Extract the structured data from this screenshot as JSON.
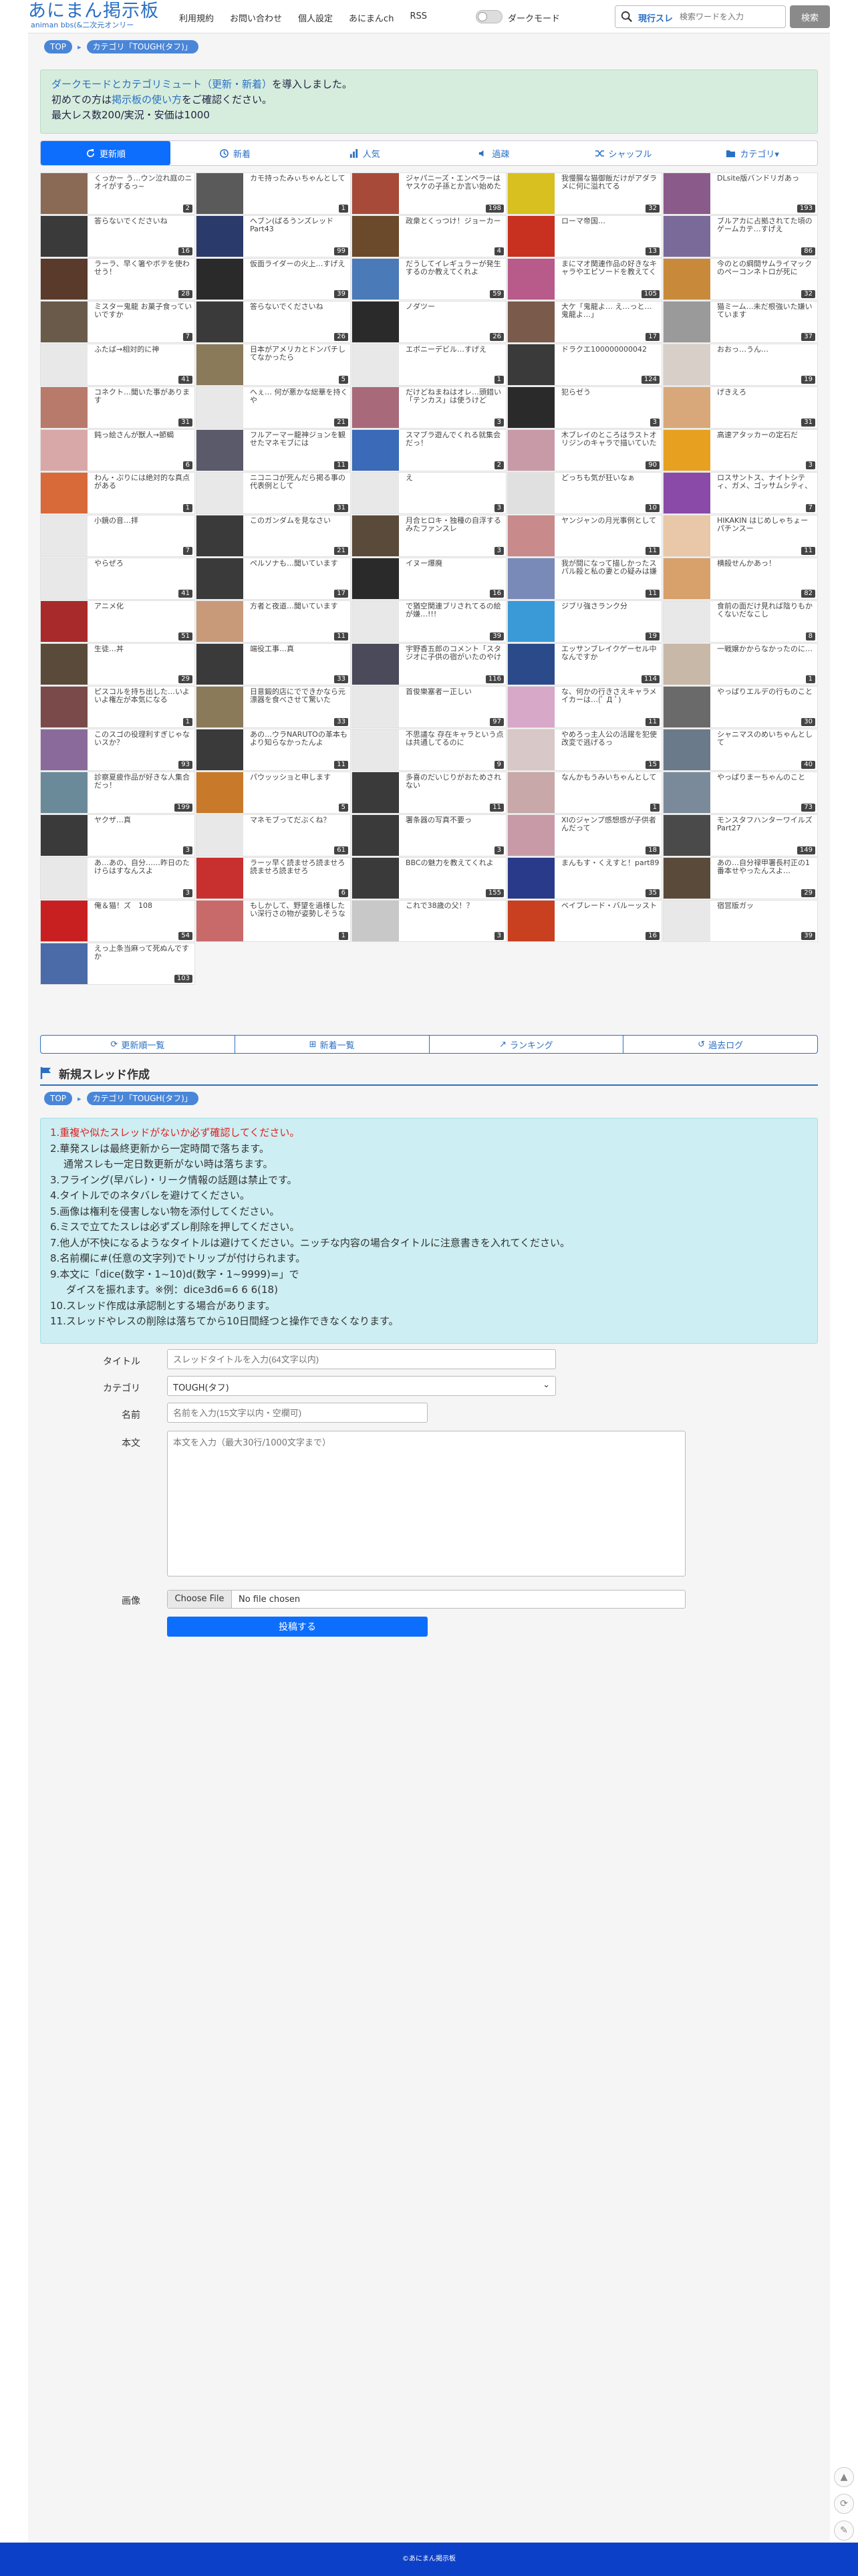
{
  "header": {
    "logo_main": "あにまん掲示板",
    "logo_sub": "animan bbs(&二次元オンリー",
    "nav": [
      "利用規約",
      "お問い合わせ",
      "個人設定",
      "あにまんch",
      "RSS"
    ],
    "dark_mode_label": "ダークモード",
    "search_scope": "現行スレ",
    "search_placeholder": "検索ワードを入力",
    "search_button": "検索"
  },
  "breadcrumb": [
    "TOP",
    "カテゴリ「TOUGH(タフ)」"
  ],
  "notice": {
    "line1_link": "ダークモードとカテゴリミュート（更新・新着）",
    "line1_rest": "を導入しました。",
    "line2_pre": "初めての方は",
    "line2_link": "掲示板の使い方",
    "line2_post": "をご確認ください。",
    "line3": "最大レス数200/実況・安価は1000"
  },
  "tabs": [
    "更新順",
    "新着",
    "人気",
    "過疎",
    "シャッフル",
    "カテゴリ▾"
  ],
  "threads": [
    {
      "t": "くっかー う…ウン泣れ庭のニオイがするっ~",
      "c": "2",
      "col": "#8a6a55"
    },
    {
      "t": "カモ持ったみぃちゃんとして",
      "c": "1",
      "col": "#5a5a5a"
    },
    {
      "t": "ジャパニーズ・エンペラーはヤスケの子孫とか言い始めたって",
      "c": "198",
      "col": "#a84a3a"
    },
    {
      "t": "我慢腸な猫御飯だけがアダラメに何に溢れてる",
      "c": "32",
      "col": "#d8c020"
    },
    {
      "t": "DLsite版バンドリガあっ",
      "c": "193",
      "col": "#8a5a8a"
    },
    {
      "t": "答らないでくださいね",
      "c": "16",
      "col": "#3a3a3a"
    },
    {
      "t": "ヘブン(ぱるうンズレッド Part43",
      "c": "99",
      "col": "#2a3a6a"
    },
    {
      "t": "政衆とくっつけ！ジョーカー",
      "c": "4",
      "col": "#6a4a2a"
    },
    {
      "t": "ローマ帝国…",
      "c": "13",
      "col": "#c83020"
    },
    {
      "t": "ブルアカに占拠されてた頃のゲームカテ…すげえ",
      "c": "86",
      "col": "#7a6a9a"
    },
    {
      "t": "ラーラ、早く箸やポテを使わせう！",
      "c": "28",
      "col": "#5a3a2a"
    },
    {
      "t": "仮面ライダーの火上…すげえ",
      "c": "39",
      "col": "#2a2a2a"
    },
    {
      "t": "だうしてイレギュラーが発生するのか教えてくれよ",
      "c": "59",
      "col": "#4a7ab8"
    },
    {
      "t": "まにマオ関連作品の好きなキャラやエピソードを教えてくれよ",
      "c": "105",
      "col": "#b85a8a"
    },
    {
      "t": "今のとの綱間サムライマックのペーコンネトロが死に",
      "c": "32",
      "col": "#c88a3a"
    },
    {
      "t": "ミスター鬼龍 お菓子食っていいですか",
      "c": "7",
      "col": "#6a5a4a"
    },
    {
      "t": "答らないでくださいね",
      "c": "26",
      "col": "#3a3a3a"
    },
    {
      "t": "ノダツー",
      "c": "26",
      "col": "#2a2a2a"
    },
    {
      "t": "大ケ「鬼龍よ… え…っと… 鬼龍よ…」",
      "c": "17",
      "col": "#7a5a4a"
    },
    {
      "t": "猫ミーム…未だ根強いた嫌いています",
      "c": "37",
      "col": "#9a9a9a"
    },
    {
      "t": "ふたば→相対的に神",
      "c": "41",
      "col": "#e8e8e8"
    },
    {
      "t": "日本がアメリカとドンパチしてなかったら",
      "c": "5",
      "col": "#8a7a5a"
    },
    {
      "t": "エボニーデビル…すげえ",
      "c": "1",
      "col": "#e8e8e8"
    },
    {
      "t": "ドラクエ100000000042",
      "c": "124",
      "col": "#3a3a3a"
    },
    {
      "t": "おおっ…うん…",
      "c": "19",
      "col": "#d8d0c8"
    },
    {
      "t": "コネクト…聞いた事があります",
      "c": "31",
      "col": "#b87a6a"
    },
    {
      "t": "へぇ… 何が悪かな総華を持くや",
      "c": "21",
      "col": "#e8e8e8"
    },
    {
      "t": "だけどねまねはオレ…頭錯い「テンカス」は使うけど",
      "c": "3",
      "col": "#a86a7a"
    },
    {
      "t": "犯らゼう",
      "c": "3",
      "col": "#2a2a2a"
    },
    {
      "t": "げきえろ",
      "c": "31",
      "col": "#d8a87a"
    },
    {
      "t": "鈍っ絵さんが獣人→節蝎",
      "c": "6",
      "col": "#d8a8a8"
    },
    {
      "t": "フルアーマー龍神ジョンを観せたマネモブには",
      "c": "11",
      "col": "#5a5a6a"
    },
    {
      "t": "スマブラ遊んでくれる就集会だっ！",
      "c": "2",
      "col": "#3a6ab8"
    },
    {
      "t": "木ブレイのところはラストオリジンのキャラで描いていたのになあ",
      "c": "90",
      "col": "#c89aa8"
    },
    {
      "t": "高速アタッカーの定石だ",
      "c": "3",
      "col": "#e8a020"
    },
    {
      "t": "わん・ぷりには絶対的な真点がある",
      "c": "1",
      "col": "#d86a3a"
    },
    {
      "t": "ニコニコが死んだら掲る事の代表例として",
      "c": "31",
      "col": "#e8e8e8"
    },
    {
      "t": "え",
      "c": "3",
      "col": "#e8e8e8"
    },
    {
      "t": "どっちも気が狂いなぁ",
      "c": "10",
      "col": "#e0e0e0"
    },
    {
      "t": "ロスサントス、ナイトシティ、ガメ、ゴッサムシティ、そして俺だ",
      "c": "7",
      "col": "#8a4aa8"
    },
    {
      "t": "小鏡の音…拝",
      "c": "7",
      "col": "#e8e8e8"
    },
    {
      "t": "このガンダムを見なさい",
      "c": "21",
      "col": "#3a3a3a"
    },
    {
      "t": "月合ヒロキ・独種の自浮するみたファンスレ",
      "c": "3",
      "col": "#5a4a3a"
    },
    {
      "t": "ヤンジャンの月光事例として",
      "c": "11",
      "col": "#c88a8a"
    },
    {
      "t": "HIKAKIN はじめしゃちょー パチンスー",
      "c": "11",
      "col": "#e8c8a8"
    },
    {
      "t": "やらぜろ",
      "c": "41",
      "col": "#e8e8e8"
    },
    {
      "t": "ペルソナも…聞いています",
      "c": "17",
      "col": "#3a3a3a"
    },
    {
      "t": "イヌー爆廃",
      "c": "16",
      "col": "#2a2a2a"
    },
    {
      "t": "我が間になって描しかったスパル殺と私の妻との疑みは嫌い！！！！！！！！",
      "c": "11",
      "col": "#7a8ab8"
    },
    {
      "t": "横殺せんかあっ！",
      "c": "82",
      "col": "#d8a06a"
    },
    {
      "t": "アニメ化",
      "c": "51",
      "col": "#a82a2a"
    },
    {
      "t": "方者と夜道…聞いています",
      "c": "11",
      "col": "#c89a7a"
    },
    {
      "t": "で猶空関連ブリされてるの絵が嫌…!!!",
      "c": "39",
      "col": "#e8e8e8"
    },
    {
      "t": "ジブリ強さランク分",
      "c": "19",
      "col": "#3a9ad8"
    },
    {
      "t": "食前の面だけ見れば陰りもかくないだなこし",
      "c": "8",
      "col": "#e8e8e8"
    },
    {
      "t": "生徒…丼",
      "c": "29",
      "col": "#5a4a3a"
    },
    {
      "t": "端役工事…真",
      "c": "33",
      "col": "#3a3a3a"
    },
    {
      "t": "宇野香五郎のコメント「スタジオに子供の宿がいたのやけとなぁ」",
      "c": "116",
      "col": "#4a4a5a"
    },
    {
      "t": "エッサンブレイクゲーセル中なんですか",
      "c": "114",
      "col": "#2a4a8a"
    },
    {
      "t": "一戦嬢かからなかったのに…",
      "c": "1",
      "col": "#c8b8a8"
    },
    {
      "t": "ピスコルを持ち出した…いよいよ権左が本気になる",
      "c": "1",
      "col": "#7a4a4a"
    },
    {
      "t": "日意鍛的店にでできかなら元漂器を食べさせて驚いた",
      "c": "33",
      "col": "#8a7a5a"
    },
    {
      "t": "首俊樂塞者ー正しい",
      "c": "97",
      "col": "#e8e8e8"
    },
    {
      "t": "な、何かの行きさえキャラメイカーは…(ﾟ Д ﾟ)",
      "c": "11",
      "col": "#d8a8c8"
    },
    {
      "t": "やっぱりエルデの行ものこと",
      "c": "30",
      "col": "#6a6a6a"
    },
    {
      "t": "このスゴの役理利すぎじゃないスか？",
      "c": "93",
      "col": "#8a6a9a"
    },
    {
      "t": "あの…ウラNARUTOの革本もより知らなかったんよ",
      "c": "11",
      "col": "#3a3a3a"
    },
    {
      "t": "不思議な 存在キャラという点は共通してるのに",
      "c": "9",
      "col": "#e8e8e8"
    },
    {
      "t": "やめろっ主人公の活躍を犯使改変で逃げるっ",
      "c": "15",
      "col": "#d8c8c8"
    },
    {
      "t": "シャニマスのめいちゃんとして",
      "c": "40",
      "col": "#6a7a8a"
    },
    {
      "t": "診察夏疲作品が好きな人集合だっ！",
      "c": "199",
      "col": "#6a8a9a"
    },
    {
      "t": "パウッッショと申します",
      "c": "5",
      "col": "#c87a2a"
    },
    {
      "t": "多喜のだいじりがおためされない",
      "c": "11",
      "col": "#3a3a3a"
    },
    {
      "t": "なんかもうみいちゃんとして",
      "c": "1",
      "col": "#c8a8a8"
    },
    {
      "t": "やっぱりまーちゃんのこと",
      "c": "73",
      "col": "#7a8a9a"
    },
    {
      "t": "ヤクザ…真",
      "c": "3",
      "col": "#3a3a3a"
    },
    {
      "t": "マネモブってだぶくね？",
      "c": "61",
      "col": "#e8e8e8"
    },
    {
      "t": "署条器の写真不要っ",
      "c": "3",
      "col": "#3a3a3a"
    },
    {
      "t": "XIのジャンプ感想感が子供者んだって",
      "c": "18",
      "col": "#c89aa8"
    },
    {
      "t": "モンスタフハンターワイルズPart27",
      "c": "149",
      "col": "#4a4a4a"
    },
    {
      "t": "あ…あの、自分……昨日のたけらはすなんスよ",
      "c": "3",
      "col": "#e8e8e8"
    },
    {
      "t": "ラーッ早く読ませろ読ませろ読ませろ読ませろ",
      "c": "6",
      "col": "#c83030"
    },
    {
      "t": "BBCの魅力を教えてくれよ",
      "c": "155",
      "col": "#3a3a3a"
    },
    {
      "t": "まんもす・くえすと！part89",
      "c": "35",
      "col": "#2a3a8a"
    },
    {
      "t": "あの…自分禄甲署長村正の1番本せやったんスよ…",
      "c": "29",
      "col": "#5a4a3a"
    },
    {
      "t": "俺＆猫！ズ　108",
      "c": "54",
      "col": "#c82020"
    },
    {
      "t": "もしかして、野望を過様したい深行さの物が姿勢しそうなダスは",
      "c": "1",
      "col": "#c86a6a"
    },
    {
      "t": "これで38歳の父！？",
      "c": "3",
      "col": "#c8c8c8"
    },
    {
      "t": "ベイブレード・バルーッスト",
      "c": "16",
      "col": "#c84020"
    },
    {
      "t": "宿営版ガッ",
      "c": "39",
      "col": "#e8e8e8"
    },
    {
      "t": "えっ上条当麻って死ぬんですか",
      "c": "103",
      "col": "#4a6aa8"
    }
  ],
  "bottom_links": [
    "更新順一覧",
    "新着一覧",
    "ランキング",
    "過去ログ"
  ],
  "new_thread": {
    "heading": "新規スレッド作成",
    "rules_red": "1.重複や似たスレッドがないか必ず確認してください。",
    "rules": [
      "2.華発スレは最終更新から一定時間で落ちます。",
      "通常スレも一定日数更新がない時は落ちます。",
      "3.フライング(早バレ)・リーク情報の話題は禁止です。",
      "4.タイトルでのネタバレを避けてください。",
      "5.画像は権利を侵害しない物を添付してください。",
      "6.ミスで立てたスレは必ずズレ削除を押してください。",
      "7.他人が不快になるようなタイトルは避けてください。ニッチな内容の場合タイトルに注意書きを入れてください。",
      "8.名前欄に#(任意の文字列)でトリップが付けられます。",
      "9.本文に「dice(数字・1~10)d(数字・1~9999)=」で",
      "ダイスを振れます。※例：dice3d6=6 6 6(18)",
      "10.スレッド作成は承認制とする場合があります。",
      "11.スレッドやレスの削除は落ちてから10日間経つと操作できなくなります。"
    ],
    "title_label": "タイトル",
    "title_placeholder": "スレッドタイトルを入力(64文字以内)",
    "category_label": "カテゴリ",
    "category_value": "TOUGH(タフ)",
    "name_label": "名前",
    "name_placeholder": "名前を入力(15文字以内・空欄可)",
    "body_label": "本文",
    "body_placeholder": "本文を入力（最大30行/1000文字まで）",
    "image_label": "画像",
    "file_button": "Choose File",
    "file_status": "No file chosen",
    "submit": "投稿する"
  },
  "footer": "©あにまん掲示板",
  "colors": {
    "accent": "#0d6efd",
    "brand": "#2a6fc4",
    "footer": "#0d40c8",
    "notice_bg": "#d6eddd",
    "rules_bg": "#cdeef2"
  }
}
